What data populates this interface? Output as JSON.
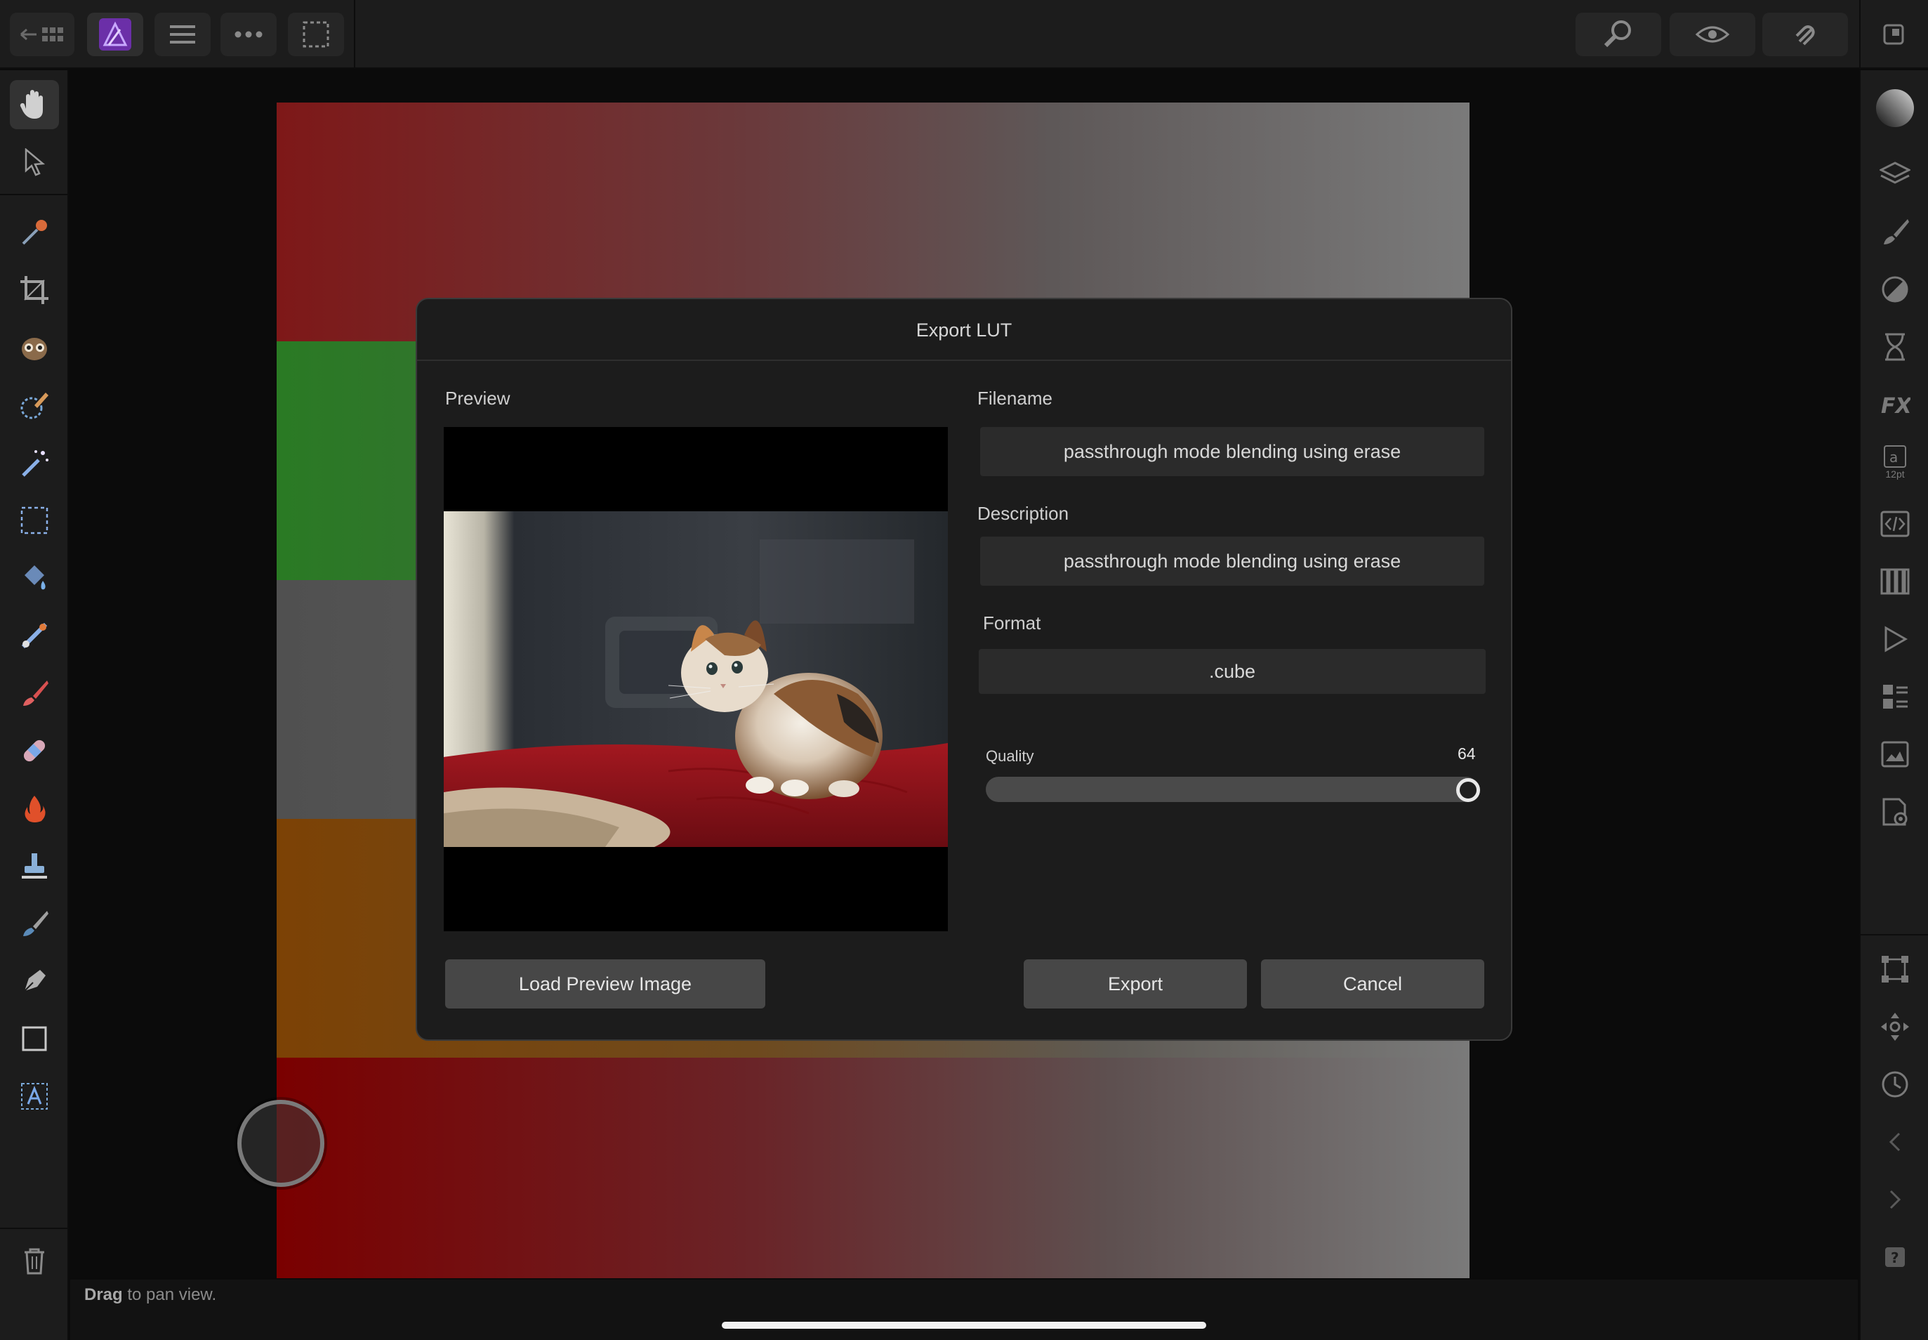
{
  "statusbar": {
    "hint_bold": "Drag",
    "hint_rest": " to pan view."
  },
  "dialog": {
    "title": "Export LUT",
    "preview_label": "Preview",
    "filename_label": "Filename",
    "filename_value": "passthrough mode blending using erase",
    "description_label": "Description",
    "description_value": "passthrough mode blending using erase",
    "format_label": "Format",
    "format_value": ".cube",
    "quality_label": "Quality",
    "quality_value": "64",
    "load_preview_label": "Load Preview Image",
    "export_label": "Export",
    "cancel_label": "Cancel"
  },
  "right_panel": {
    "font_size_badge": "12pt"
  },
  "colors": {
    "accent_brand": "#6b2fa8",
    "dialog_bg": "#1c1c1c",
    "button_bg": "#474747"
  },
  "icons": {
    "topbar": [
      "back-grid-icon",
      "app-logo-icon",
      "menu-icon",
      "more-icon",
      "selection-marquee-icon",
      "zoom-icon",
      "view-eye-icon",
      "snapping-magnet-icon",
      "window-icon"
    ],
    "left_tools": [
      "hand-icon",
      "pointer-icon",
      "eyedropper-icon",
      "crop-icon",
      "red-eye-icon",
      "brush-selection-icon",
      "magic-wand-icon",
      "marquee-icon",
      "flood-fill-icon",
      "gradient-icon",
      "paint-brush-icon",
      "healing-icon",
      "burn-icon",
      "clone-stamp-icon",
      "smudge-icon",
      "pen-icon",
      "rectangle-icon",
      "text-icon",
      "trash-icon"
    ],
    "right_tools": [
      "color-icon",
      "layers-icon",
      "brushes-icon",
      "adjustments-icon",
      "hourglass-icon",
      "fx-icon",
      "text-style-icon",
      "code-icon",
      "swatches-icon",
      "play-icon",
      "stock-icon",
      "navigator-icon",
      "settings-icon",
      "transform-icon",
      "move-icon",
      "history-icon",
      "prev-icon",
      "next-icon",
      "help-icon"
    ]
  }
}
